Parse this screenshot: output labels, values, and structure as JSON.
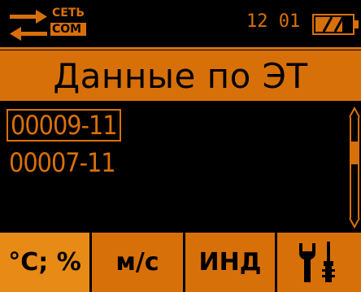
{
  "status": {
    "connection": {
      "top_label": "СЕТЬ",
      "bottom_label": "COM"
    },
    "clock": "12 01",
    "battery_level": 0.75
  },
  "title": "Данные по ЭТ",
  "list": {
    "items": [
      {
        "label": "00009-11",
        "selected": true
      },
      {
        "label": "00007-11",
        "selected": false
      }
    ]
  },
  "softkeys": [
    {
      "label": "°C; %",
      "active": true
    },
    {
      "label": "м/с",
      "active": false
    },
    {
      "label": "ИНД",
      "active": false
    },
    {
      "icon": "tools-icon",
      "active": false
    }
  ],
  "colors": {
    "accent": "#d8700a",
    "background": "#000000"
  }
}
